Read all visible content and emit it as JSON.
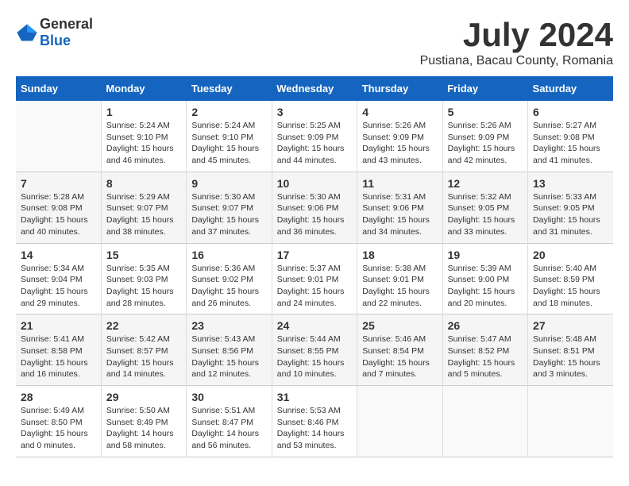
{
  "logo": {
    "general": "General",
    "blue": "Blue"
  },
  "title": {
    "month_year": "July 2024",
    "location": "Pustiana, Bacau County, Romania"
  },
  "headers": [
    "Sunday",
    "Monday",
    "Tuesday",
    "Wednesday",
    "Thursday",
    "Friday",
    "Saturday"
  ],
  "weeks": [
    [
      {
        "day": "",
        "info": ""
      },
      {
        "day": "1",
        "info": "Sunrise: 5:24 AM\nSunset: 9:10 PM\nDaylight: 15 hours\nand 46 minutes."
      },
      {
        "day": "2",
        "info": "Sunrise: 5:24 AM\nSunset: 9:10 PM\nDaylight: 15 hours\nand 45 minutes."
      },
      {
        "day": "3",
        "info": "Sunrise: 5:25 AM\nSunset: 9:09 PM\nDaylight: 15 hours\nand 44 minutes."
      },
      {
        "day": "4",
        "info": "Sunrise: 5:26 AM\nSunset: 9:09 PM\nDaylight: 15 hours\nand 43 minutes."
      },
      {
        "day": "5",
        "info": "Sunrise: 5:26 AM\nSunset: 9:09 PM\nDaylight: 15 hours\nand 42 minutes."
      },
      {
        "day": "6",
        "info": "Sunrise: 5:27 AM\nSunset: 9:08 PM\nDaylight: 15 hours\nand 41 minutes."
      }
    ],
    [
      {
        "day": "7",
        "info": "Sunrise: 5:28 AM\nSunset: 9:08 PM\nDaylight: 15 hours\nand 40 minutes."
      },
      {
        "day": "8",
        "info": "Sunrise: 5:29 AM\nSunset: 9:07 PM\nDaylight: 15 hours\nand 38 minutes."
      },
      {
        "day": "9",
        "info": "Sunrise: 5:30 AM\nSunset: 9:07 PM\nDaylight: 15 hours\nand 37 minutes."
      },
      {
        "day": "10",
        "info": "Sunrise: 5:30 AM\nSunset: 9:06 PM\nDaylight: 15 hours\nand 36 minutes."
      },
      {
        "day": "11",
        "info": "Sunrise: 5:31 AM\nSunset: 9:06 PM\nDaylight: 15 hours\nand 34 minutes."
      },
      {
        "day": "12",
        "info": "Sunrise: 5:32 AM\nSunset: 9:05 PM\nDaylight: 15 hours\nand 33 minutes."
      },
      {
        "day": "13",
        "info": "Sunrise: 5:33 AM\nSunset: 9:05 PM\nDaylight: 15 hours\nand 31 minutes."
      }
    ],
    [
      {
        "day": "14",
        "info": "Sunrise: 5:34 AM\nSunset: 9:04 PM\nDaylight: 15 hours\nand 29 minutes."
      },
      {
        "day": "15",
        "info": "Sunrise: 5:35 AM\nSunset: 9:03 PM\nDaylight: 15 hours\nand 28 minutes."
      },
      {
        "day": "16",
        "info": "Sunrise: 5:36 AM\nSunset: 9:02 PM\nDaylight: 15 hours\nand 26 minutes."
      },
      {
        "day": "17",
        "info": "Sunrise: 5:37 AM\nSunset: 9:01 PM\nDaylight: 15 hours\nand 24 minutes."
      },
      {
        "day": "18",
        "info": "Sunrise: 5:38 AM\nSunset: 9:01 PM\nDaylight: 15 hours\nand 22 minutes."
      },
      {
        "day": "19",
        "info": "Sunrise: 5:39 AM\nSunset: 9:00 PM\nDaylight: 15 hours\nand 20 minutes."
      },
      {
        "day": "20",
        "info": "Sunrise: 5:40 AM\nSunset: 8:59 PM\nDaylight: 15 hours\nand 18 minutes."
      }
    ],
    [
      {
        "day": "21",
        "info": "Sunrise: 5:41 AM\nSunset: 8:58 PM\nDaylight: 15 hours\nand 16 minutes."
      },
      {
        "day": "22",
        "info": "Sunrise: 5:42 AM\nSunset: 8:57 PM\nDaylight: 15 hours\nand 14 minutes."
      },
      {
        "day": "23",
        "info": "Sunrise: 5:43 AM\nSunset: 8:56 PM\nDaylight: 15 hours\nand 12 minutes."
      },
      {
        "day": "24",
        "info": "Sunrise: 5:44 AM\nSunset: 8:55 PM\nDaylight: 15 hours\nand 10 minutes."
      },
      {
        "day": "25",
        "info": "Sunrise: 5:46 AM\nSunset: 8:54 PM\nDaylight: 15 hours\nand 7 minutes."
      },
      {
        "day": "26",
        "info": "Sunrise: 5:47 AM\nSunset: 8:52 PM\nDaylight: 15 hours\nand 5 minutes."
      },
      {
        "day": "27",
        "info": "Sunrise: 5:48 AM\nSunset: 8:51 PM\nDaylight: 15 hours\nand 3 minutes."
      }
    ],
    [
      {
        "day": "28",
        "info": "Sunrise: 5:49 AM\nSunset: 8:50 PM\nDaylight: 15 hours\nand 0 minutes."
      },
      {
        "day": "29",
        "info": "Sunrise: 5:50 AM\nSunset: 8:49 PM\nDaylight: 14 hours\nand 58 minutes."
      },
      {
        "day": "30",
        "info": "Sunrise: 5:51 AM\nSunset: 8:47 PM\nDaylight: 14 hours\nand 56 minutes."
      },
      {
        "day": "31",
        "info": "Sunrise: 5:53 AM\nSunset: 8:46 PM\nDaylight: 14 hours\nand 53 minutes."
      },
      {
        "day": "",
        "info": ""
      },
      {
        "day": "",
        "info": ""
      },
      {
        "day": "",
        "info": ""
      }
    ]
  ]
}
